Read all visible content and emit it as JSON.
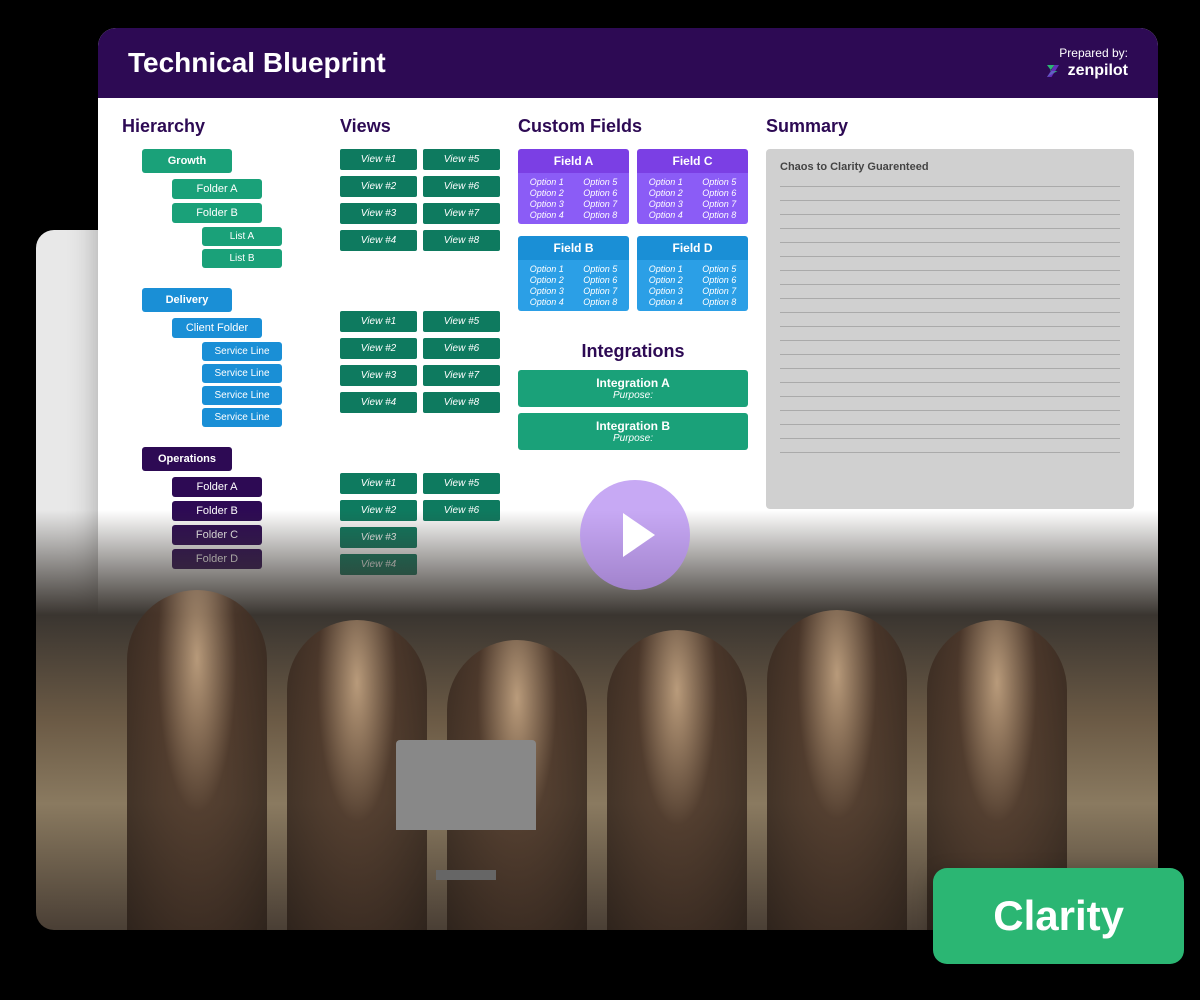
{
  "header": {
    "title": "Technical Blueprint",
    "prepared_by_label": "Prepared by:",
    "brand": "zenpilot"
  },
  "columns": {
    "hierarchy_title": "Hierarchy",
    "views_title": "Views",
    "fields_title": "Custom Fields",
    "summary_title": "Summary"
  },
  "hierarchy": {
    "growth": {
      "root": "Growth",
      "folders": [
        "Folder A",
        "Folder B"
      ],
      "lists": [
        "List A",
        "List B"
      ]
    },
    "delivery": {
      "root": "Delivery",
      "folder": "Client Folder",
      "lines": [
        "Service Line",
        "Service Line",
        "Service Line",
        "Service Line"
      ]
    },
    "operations": {
      "root": "Operations",
      "folders": [
        "Folder A",
        "Folder B",
        "Folder C",
        "Folder D"
      ]
    }
  },
  "views": {
    "set1": [
      "View #1",
      "View #2",
      "View #3",
      "View #4",
      "View #5",
      "View #6",
      "View #7",
      "View #8"
    ],
    "set2": [
      "View #1",
      "View #2",
      "View #3",
      "View #4",
      "View #5",
      "View #6",
      "View #7",
      "View #8"
    ],
    "set3": [
      "View #1",
      "View #2",
      "View #3",
      "View #4",
      "View #5",
      "View #6"
    ]
  },
  "fields": {
    "a": {
      "name": "Field A",
      "opts": [
        "Option 1",
        "Option 2",
        "Option 3",
        "Option 4",
        "Option 5",
        "Option 6",
        "Option 7",
        "Option 8"
      ]
    },
    "c": {
      "name": "Field C",
      "opts": [
        "Option 1",
        "Option 2",
        "Option 3",
        "Option 4",
        "Option 5",
        "Option 6",
        "Option 7",
        "Option 8"
      ]
    },
    "b": {
      "name": "Field B",
      "opts": [
        "Option 1",
        "Option 2",
        "Option 3",
        "Option 4",
        "Option 5",
        "Option 6",
        "Option 7",
        "Option 8"
      ]
    },
    "d": {
      "name": "Field D",
      "opts": [
        "Option 1",
        "Option 2",
        "Option 3",
        "Option 4",
        "Option 5",
        "Option 6",
        "Option 7",
        "Option 8"
      ]
    }
  },
  "integrations": {
    "title": "Integrations",
    "items": [
      {
        "name": "Integration A",
        "purpose": "Purpose:"
      },
      {
        "name": "Integration B",
        "purpose": "Purpose:"
      }
    ]
  },
  "summary": {
    "heading": "Chaos to Clarity Guarenteed"
  },
  "clarity_button": "Clarity"
}
